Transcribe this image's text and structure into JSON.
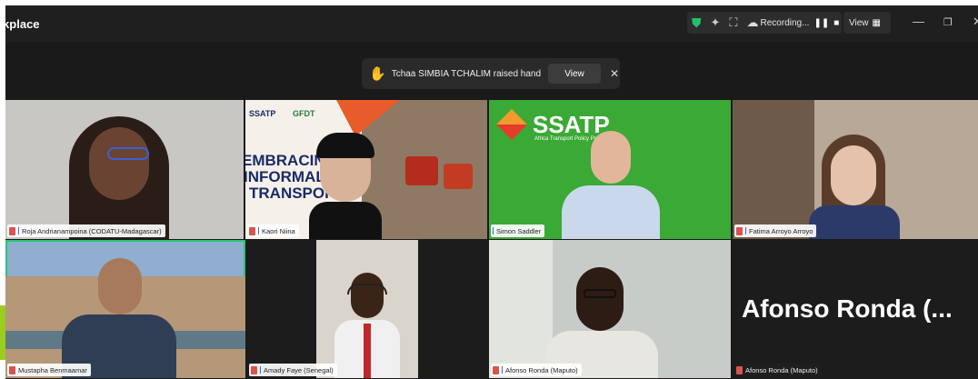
{
  "app": {
    "brand_line1": "m",
    "brand_line2": "rkplace"
  },
  "toolbar": {
    "recording_label": "Recording...",
    "view_label": "View"
  },
  "toast": {
    "message": "Tchaa SIMBIA TCHALIM raised hand",
    "view_button": "View",
    "close_symbol": "✕"
  },
  "tiles": [
    {
      "name": "Roja Andrianampoina (CODATU-Madagascar)"
    },
    {
      "name": "Kaori Niina"
    },
    {
      "name": "Simon Saddler"
    },
    {
      "name": "Fatima Arroyo Arroyo"
    },
    {
      "name": "Mustapha Benmaamar"
    },
    {
      "name": "Amady Faye (Senegal)"
    },
    {
      "name": "Afonso Ronda (Maputo)"
    },
    {
      "name": "Afonso Ronda (Maputo)",
      "display": "Afonso Ronda (..."
    }
  ],
  "slide": {
    "logo1": "SSATP",
    "logo2": "GFDT",
    "line1": "EMBRACING",
    "line2": "INFORMAL",
    "line3": "TRANSPORT"
  },
  "ssatp": {
    "logo": "SSATP",
    "tagline": "Africa Transport Policy Pr"
  },
  "colors": {
    "accent_green": "#28c76f",
    "ssatp_green": "#3aa935",
    "toolbar_bg": "#1f1f1f"
  }
}
